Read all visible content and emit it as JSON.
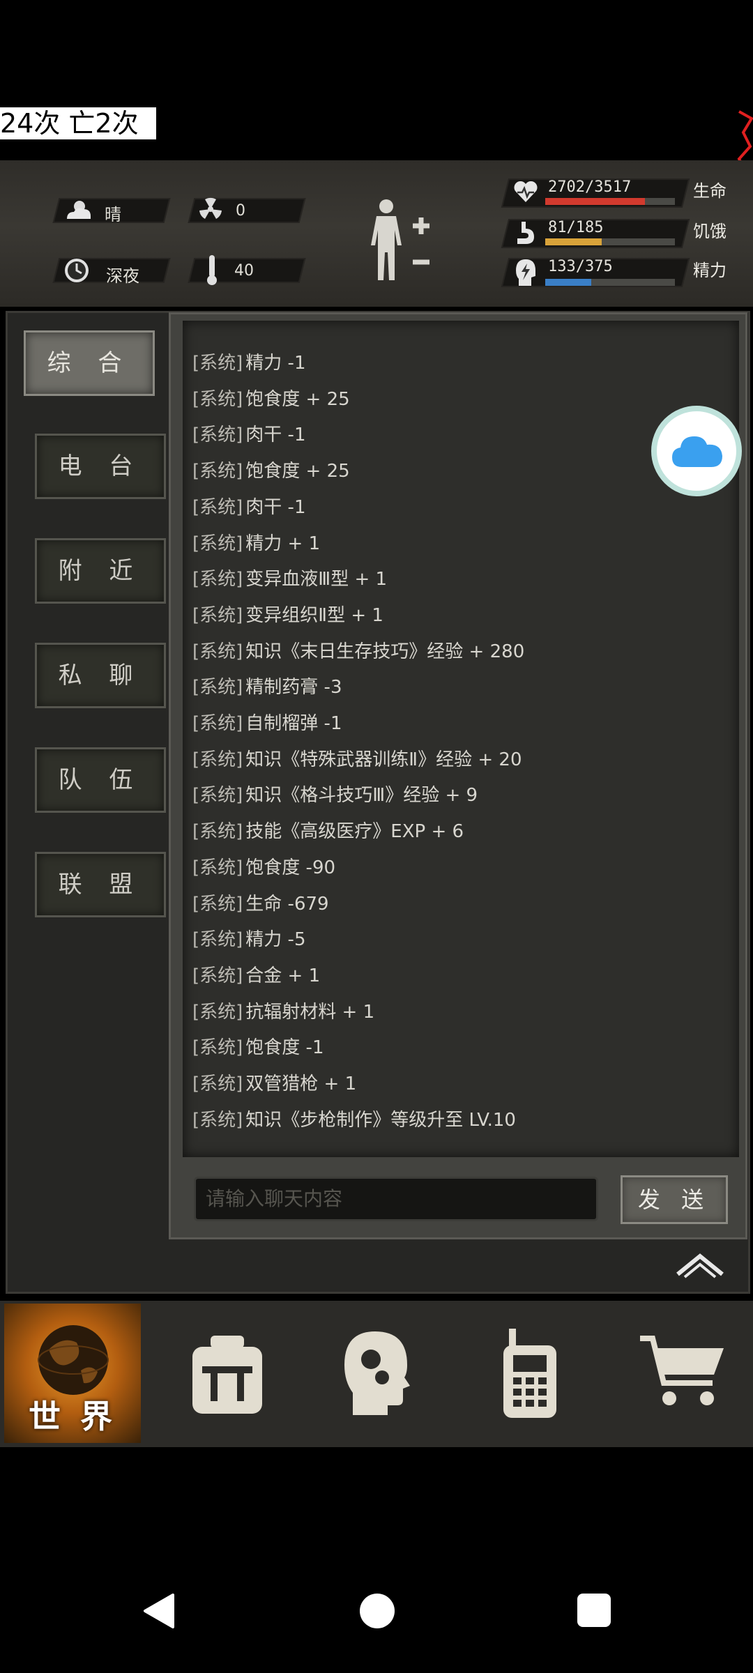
{
  "overlay": {
    "text": "24次 亡2次"
  },
  "hud": {
    "weather": "晴",
    "radiation": "0",
    "time_of_day": "深夜",
    "temperature": "40",
    "stats": [
      {
        "name": "生命",
        "value": "2702/3517",
        "fraction": 0.768,
        "color": "#d23a2e"
      },
      {
        "name": "饥饿",
        "value": "81/185",
        "fraction": 0.438,
        "color": "#d9a33a"
      },
      {
        "name": "精力",
        "value": "133/375",
        "fraction": 0.355,
        "color": "#3a7fc7"
      }
    ]
  },
  "side_tabs": [
    "综 合",
    "电 台",
    "附 近",
    "私 聊",
    "队 伍",
    "联 盟"
  ],
  "chat": {
    "messages": [
      {
        "tag": "[系统]",
        "text": "精力 -1"
      },
      {
        "tag": "[系统]",
        "text": "饱食度 + 25"
      },
      {
        "tag": "[系统]",
        "text": "肉干 -1"
      },
      {
        "tag": "[系统]",
        "text": "饱食度 + 25"
      },
      {
        "tag": "[系统]",
        "text": "肉干 -1"
      },
      {
        "tag": "[系统]",
        "text": "精力 + 1"
      },
      {
        "tag": "[系统]",
        "text": "变异血液Ⅲ型 + 1"
      },
      {
        "tag": "[系统]",
        "text": "变异组织Ⅱ型 + 1"
      },
      {
        "tag": "[系统]",
        "text": "知识《末日生存技巧》经验 + 280"
      },
      {
        "tag": "[系统]",
        "text": "精制药膏 -3"
      },
      {
        "tag": "[系统]",
        "text": "自制榴弹 -1"
      },
      {
        "tag": "[系统]",
        "text": "知识《特殊武器训练Ⅱ》经验 + 20"
      },
      {
        "tag": "[系统]",
        "text": "知识《格斗技巧Ⅲ》经验 + 9"
      },
      {
        "tag": "[系统]",
        "text": "技能《高级医疗》EXP + 6"
      },
      {
        "tag": "[系统]",
        "text": "饱食度 -90"
      },
      {
        "tag": "[系统]",
        "text": "生命 -679"
      },
      {
        "tag": "[系统]",
        "text": "精力 -5"
      },
      {
        "tag": "[系统]",
        "text": "合金 + 1"
      },
      {
        "tag": "[系统]",
        "text": "抗辐射材料 + 1"
      },
      {
        "tag": "[系统]",
        "text": "饱食度 -1"
      },
      {
        "tag": "[系统]",
        "text": "双管猎枪 + 1"
      },
      {
        "tag": "[系统]",
        "text": "知识《步枪制作》等级升至 LV.10"
      }
    ],
    "input_placeholder": "请输入聊天内容",
    "send_label": "发 送"
  },
  "bottom_nav": {
    "world_label": "世 界"
  },
  "icons": {
    "weather": "sun-cloud-icon",
    "radiation": "radiation-icon",
    "clock": "clock-icon",
    "temperature": "thermometer-icon",
    "body": "body-figure-icon",
    "cloud": "cloud-icon",
    "collapse": "chevron-up-icon",
    "bag": "backpack-icon",
    "skills": "brain-head-icon",
    "radio": "walkie-talkie-icon",
    "shop": "cart-icon"
  }
}
